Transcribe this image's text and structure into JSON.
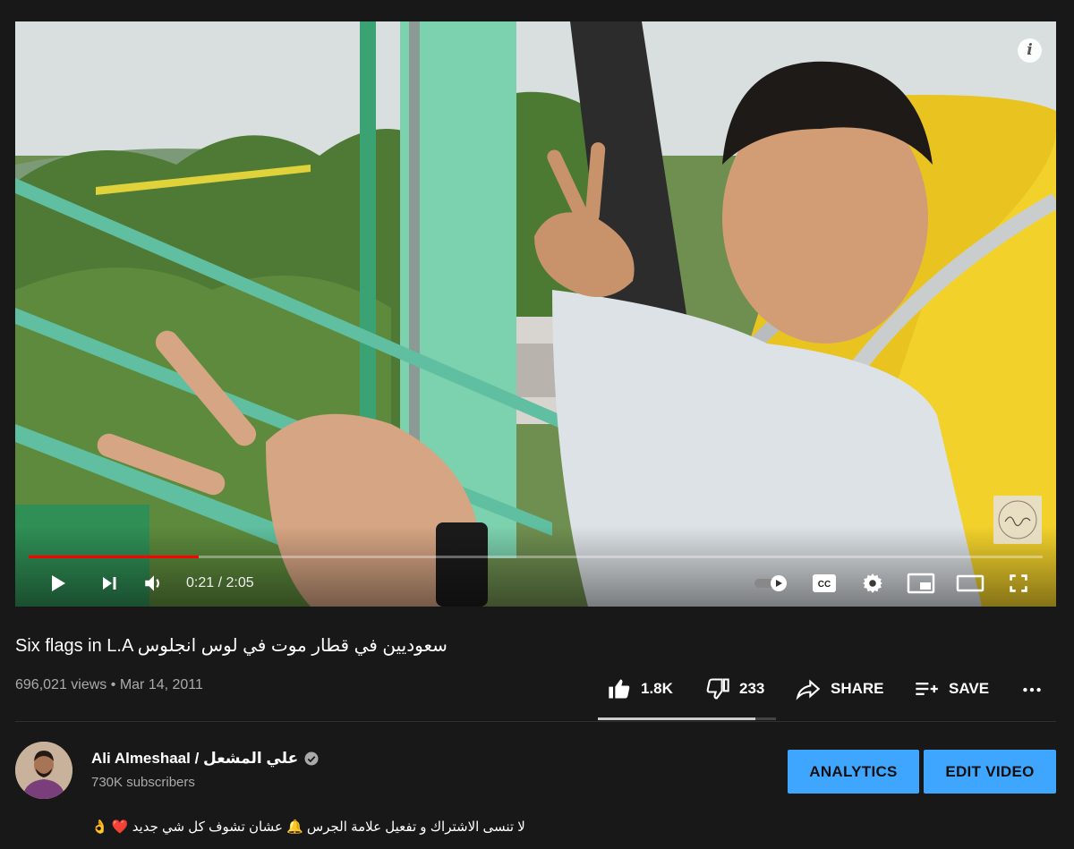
{
  "player": {
    "info_label": "i",
    "current_time": "0:21",
    "duration": "2:05",
    "time_separator": "/",
    "progress_fraction": 0.168,
    "watermark_text": "Ali Almeshaal"
  },
  "video": {
    "title": "Six flags in L.A سعوديين في قطار موت في لوس انجلوس",
    "views": "696,021 views",
    "date": "Mar 14, 2011",
    "meta_separator": "•"
  },
  "actions": {
    "like_count": "1.8K",
    "dislike_count": "233",
    "share_label": "SHARE",
    "save_label": "SAVE",
    "like_ratio": 0.886
  },
  "channel": {
    "name": "Ali Almeshaal / علي المشعل",
    "subscribers": "730K subscribers"
  },
  "buttons": {
    "analytics": "ANALYTICS",
    "edit_video": "EDIT VIDEO"
  },
  "description": {
    "text": "لا تنسى الاشتراك و تفعيل علامة الجرس 🔔 عشان تشوف كل شي جديد ❤️ 👌"
  },
  "colors": {
    "page_background": "#181818",
    "progress_played": "#ff0000",
    "accent_blue": "#3ea6ff",
    "secondary_text": "#aaaaaa"
  },
  "icons": {
    "player": [
      "play-icon",
      "next-icon",
      "volume-icon",
      "autoplay-toggle-icon",
      "captions-icon",
      "settings-icon",
      "miniplayer-icon",
      "theater-icon",
      "fullscreen-icon"
    ],
    "actions": [
      "thumbs-up-icon",
      "thumbs-down-icon",
      "share-icon",
      "save-playlist-icon",
      "more-icon"
    ],
    "channel": [
      "verified-icon"
    ]
  }
}
